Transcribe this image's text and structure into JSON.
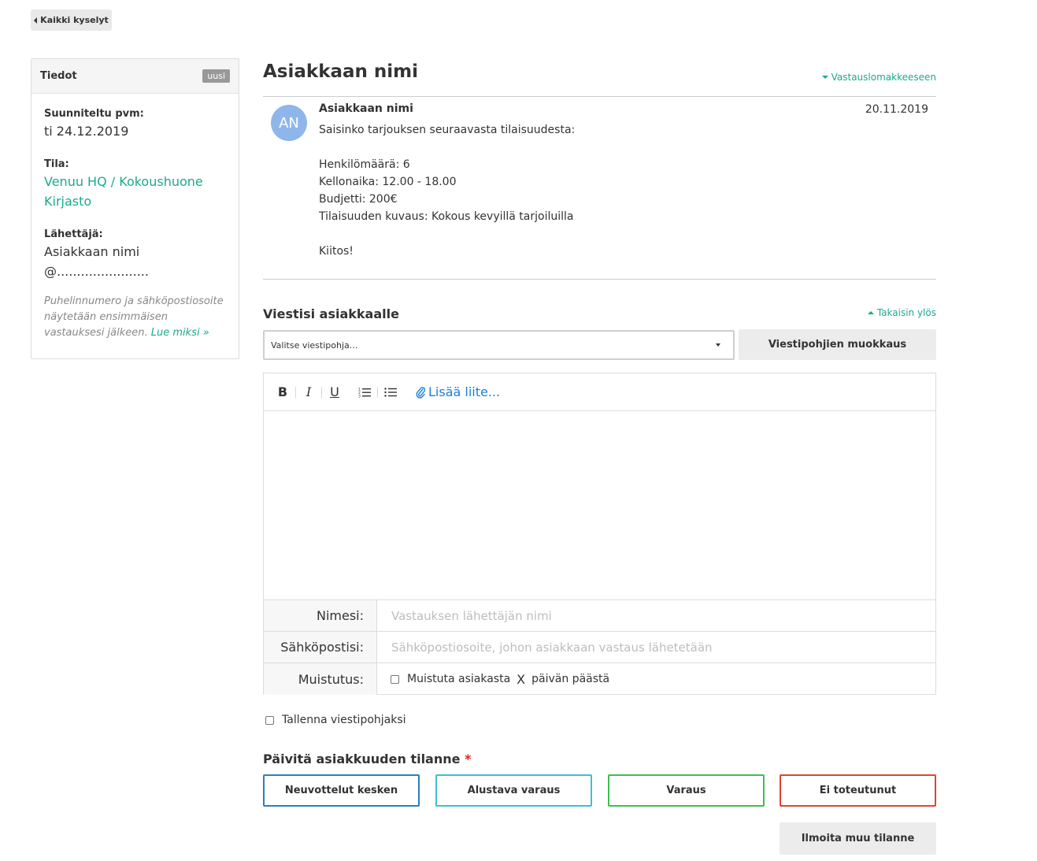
{
  "nav": {
    "back_label": "Kaikki kyselyt"
  },
  "sidebar": {
    "title": "Tiedot",
    "badge": "uusi",
    "planned_date_label": "Suunniteltu pvm:",
    "planned_date_value": "ti 24.12.2019",
    "space_label": "Tila:",
    "space_line1": "Venuu HQ / Kokoushuone",
    "space_line2": "Kirjasto",
    "sender_label": "Lähettäjä:",
    "sender_name": "Asiakkaan nimi",
    "sender_email": "@.......................",
    "note": "Puhelinnumero ja sähköpostiosoite näytetään ensimmäisen vastauksesi jälkeen.",
    "note_link": "Lue miksi »"
  },
  "main": {
    "title": "Asiakkaan nimi",
    "to_form_link": "Vastauslomakkeeseen",
    "message": {
      "avatar_initials": "AN",
      "sender": "Asiakkaan nimi",
      "date": "20.11.2019",
      "lines": [
        "Saisinko tarjouksen seuraavasta tilaisuudesta:",
        "",
        "Henkilömäärä: 6",
        "Kellonaika: 12.00 - 18.00",
        "Budjetti: 200€",
        "Tilaisuuden kuvaus: Kokous kevyillä tarjoiluilla",
        "",
        "Kiitos!"
      ]
    },
    "reply": {
      "heading": "Viestisi asiakkaalle",
      "back_to_top": "Takaisin ylös",
      "template_select_value": "Valitse viestipohja...",
      "template_edit_button": "Viestipohjien muokkaus",
      "toolbar": {
        "bold": "B",
        "italic": "I",
        "underline": "U",
        "attach": "Lisää liite..."
      },
      "fields": {
        "name_label": "Nimesi:",
        "name_placeholder": "Vastauksen lähettäjän nimi",
        "email_label": "Sähköpostisi:",
        "email_placeholder": "Sähköpostiosoite, johon asiakkaan vastaus lähetetään",
        "reminder_label": "Muistutus:",
        "reminder_text_before": "Muistuta asiakasta",
        "reminder_days": "X",
        "reminder_text_after": "päivän päästä"
      },
      "save_template_label": "Tallenna viestipohjaksi"
    },
    "status": {
      "heading": "Päivitä asiakkuuden tilanne",
      "required_mark": "*",
      "buttons": [
        {
          "label": "Neuvottelut kesken",
          "color": "#2a7fc1"
        },
        {
          "label": "Alustava varaus",
          "color": "#3fc0d0"
        },
        {
          "label": "Varaus",
          "color": "#3cbf4f"
        },
        {
          "label": "Ei toteutunut",
          "color": "#e0452e"
        }
      ],
      "other_button": "Ilmoita muu tilanne"
    }
  }
}
